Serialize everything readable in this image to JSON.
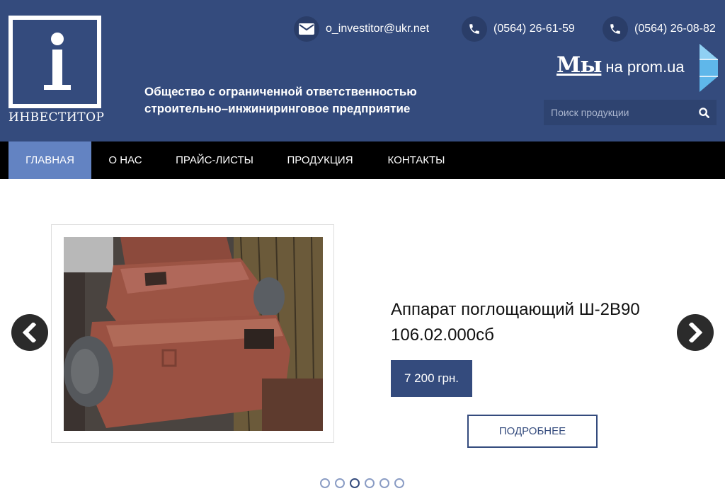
{
  "logo": {
    "letter": "i",
    "caption": "ИНВЕСТИТОР"
  },
  "company": {
    "line1": "Общество с ограниченной ответственностью",
    "line2": "строительно–инжиниринговое предприятие"
  },
  "contacts": {
    "email": "o_investitor@ukr.net",
    "phone1": "(0564) 26-61-59",
    "phone2": "(0564) 26-08-82"
  },
  "prom": {
    "my": "Мы",
    "na": "на prom.ua"
  },
  "search": {
    "placeholder": "Поиск продукции"
  },
  "nav": {
    "items": [
      {
        "label": "ГЛАВНАЯ",
        "active": true
      },
      {
        "label": "О НАС"
      },
      {
        "label": "ПРАЙС-ЛИСТЫ"
      },
      {
        "label": "ПРОДУКЦИЯ"
      },
      {
        "label": "КОНТАКТЫ"
      }
    ]
  },
  "slider": {
    "product_title_line1": "Аппарат поглощающий Ш-2В90",
    "product_title_line2": "106.02.000сб",
    "price": "7 200 грн.",
    "more_label": "ПОДРОБНЕЕ",
    "slide_count": 6,
    "active_slide": 3
  },
  "colors": {
    "header_bg": "#344b7d",
    "nav_bg": "#000000",
    "nav_active": "#6383c2",
    "accent": "#344b7d"
  },
  "icons": [
    "envelope-icon",
    "phone-icon",
    "search-icon",
    "chevron-left-icon",
    "chevron-right-icon"
  ]
}
